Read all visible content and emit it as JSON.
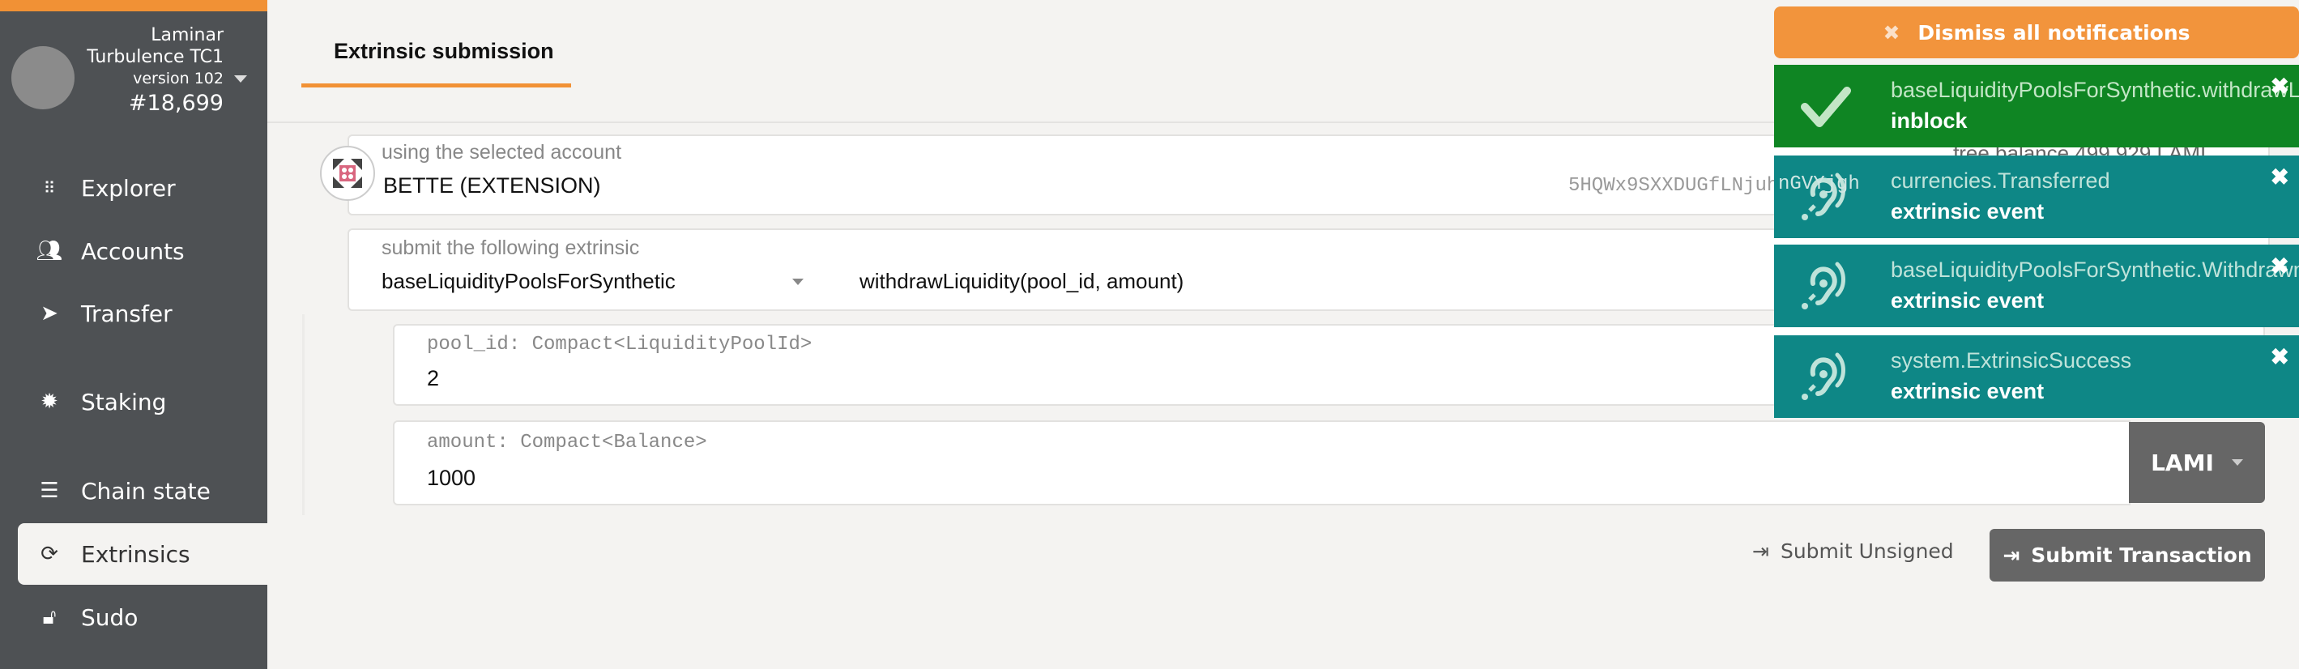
{
  "sidebar": {
    "chain_name_1": "Laminar",
    "chain_name_2": "Turbulence TC1",
    "version": "version 102",
    "block": "#18,699",
    "items": [
      {
        "label": "Explorer",
        "icon": "explorer-icon"
      },
      {
        "label": "Accounts",
        "icon": "users-icon"
      },
      {
        "label": "Transfer",
        "icon": "paper-plane-icon"
      },
      {
        "label": "Staking",
        "icon": "certificate-icon"
      },
      {
        "label": "Chain state",
        "icon": "database-icon"
      },
      {
        "label": "Extrinsics",
        "icon": "sync-icon",
        "active": true
      },
      {
        "label": "Sudo",
        "icon": "unlock-icon"
      }
    ]
  },
  "tabs": [
    {
      "label": "Extrinsic submission",
      "active": true
    }
  ],
  "account": {
    "label": "using the selected account",
    "name": "BETTE (EXTENSION)",
    "address": "5HQWx9SXXDUGfLNjuh",
    "address_end": "nGVYjgh",
    "balance": "free balance 499.929 LAMI"
  },
  "extrinsic": {
    "label": "submit the following extrinsic",
    "module": "baseLiquidityPoolsForSynthetic",
    "method": "withdrawLiquidity(pool_id, amount)"
  },
  "params": [
    {
      "label": "pool_id: Compact<LiquidityPoolId>",
      "value": "2"
    },
    {
      "label": "amount: Compact<Balance>",
      "value": "1000",
      "unit": "LAMI"
    }
  ],
  "actions": {
    "unsigned": "Submit Unsigned",
    "submit": "Submit Transaction"
  },
  "notifications": {
    "dismiss_all": "Dismiss all notifications",
    "items": [
      {
        "title": "baseLiquidityPoolsForSynthetic.withdrawLiquidity",
        "status": "inblock",
        "icon": "check-icon",
        "color": "#0f8523"
      },
      {
        "title": "currencies.Transferred",
        "status": "extrinsic event",
        "icon": "assistive-listening-icon",
        "color": "#0e8786"
      },
      {
        "title": "baseLiquidityPoolsForSynthetic.Withdrawn",
        "status": "extrinsic event",
        "icon": "assistive-listening-icon",
        "color": "#0e8786"
      },
      {
        "title": "system.ExtrinsicSuccess",
        "status": "extrinsic event",
        "icon": "assistive-listening-icon",
        "color": "#0e8786"
      }
    ]
  },
  "colors": {
    "accent": "#f19135",
    "sidebar": "#4e5154",
    "button": "#666666"
  }
}
